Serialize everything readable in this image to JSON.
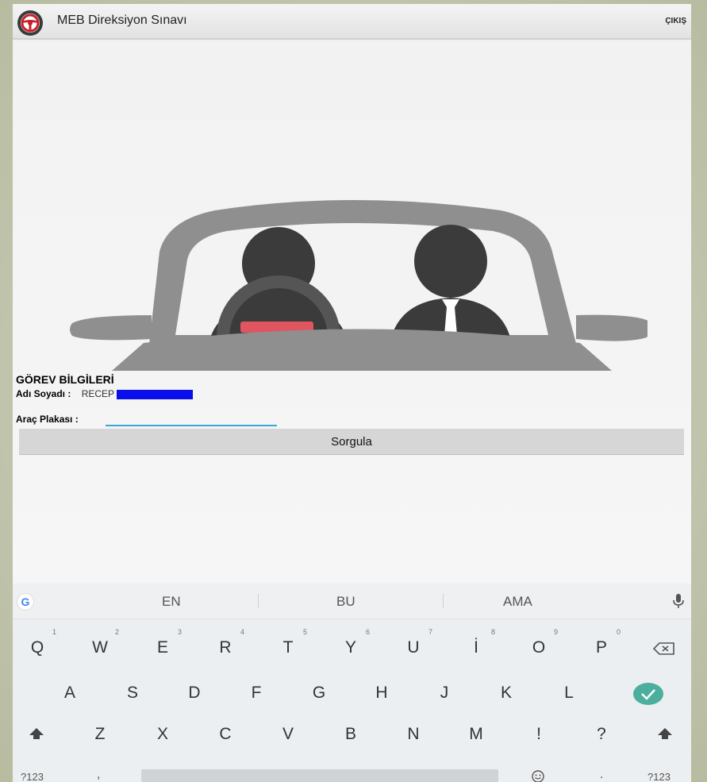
{
  "appbar": {
    "title": "MEB Direksiyon Sınavı",
    "exit_label": "ÇIKIŞ",
    "logo_icon": "steering-wheel-icon"
  },
  "form": {
    "section_title": "GÖREV BİLGİLERİ",
    "name_label": "Adı Soyadı :",
    "name_value": "RECEP",
    "plate_label": "Araç Plakası :",
    "plate_value": "",
    "query_button": "Sorgula"
  },
  "keyboard": {
    "suggestions": [
      "EN",
      "BU",
      "AMA"
    ],
    "row1": [
      {
        "key": "Q",
        "hint": "1"
      },
      {
        "key": "W",
        "hint": "2"
      },
      {
        "key": "E",
        "hint": "3"
      },
      {
        "key": "R",
        "hint": "4"
      },
      {
        "key": "T",
        "hint": "5"
      },
      {
        "key": "Y",
        "hint": "6"
      },
      {
        "key": "U",
        "hint": "7"
      },
      {
        "key": "İ",
        "hint": "8"
      },
      {
        "key": "O",
        "hint": "9"
      },
      {
        "key": "P",
        "hint": "0"
      }
    ],
    "row2": [
      "A",
      "S",
      "D",
      "F",
      "G",
      "H",
      "J",
      "K",
      "L"
    ],
    "row3": [
      "Z",
      "X",
      "C",
      "V",
      "B",
      "N",
      "M",
      "!",
      "?"
    ],
    "bottom_left": "?123",
    "comma": ",",
    "period": ".",
    "bottom_right": "?123",
    "icons": {
      "google": "google-icon",
      "mic": "microphone-icon",
      "backspace": "backspace-icon",
      "enter": "enter-check-icon",
      "shift": "shift-icon",
      "emoji": "emoji-icon"
    },
    "accent_color": "#4cae9c"
  }
}
